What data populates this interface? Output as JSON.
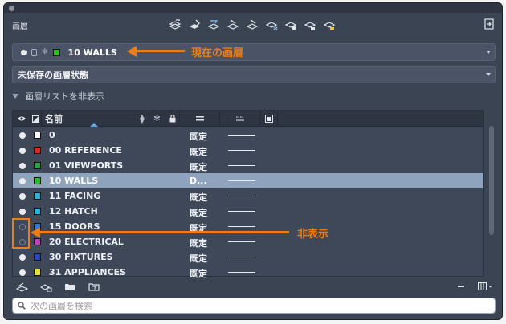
{
  "panel": {
    "label": "画層",
    "toolbar_top": [
      {
        "icon": "layer-properties-icon"
      },
      {
        "icon": "new-layer-icon"
      },
      {
        "icon": "set-current-layer-icon"
      },
      {
        "icon": "layer-match-icon"
      },
      {
        "icon": "layer-freeze-icon"
      },
      {
        "icon": "layer-isolate-icon"
      },
      {
        "icon": "layer-off-icon"
      },
      {
        "icon": "layer-lock-icon"
      },
      {
        "icon": "layer-unlock-icon"
      }
    ],
    "dock_icon": "dock-icon"
  },
  "current_layer": {
    "name": "10 WALLS",
    "color": "#22c41e"
  },
  "layer_state": {
    "label": "未保存の画層状態"
  },
  "list_toggle": {
    "label": "画層リストを非表示"
  },
  "annotations": {
    "current_layer": "現在の画層",
    "hidden": "非表示",
    "color": "#ef7d12"
  },
  "columns": {
    "name": "名前"
  },
  "layers": [
    {
      "name": "0",
      "color": "#ffffff",
      "visible": true,
      "linetype": "既定",
      "selected": false
    },
    {
      "name": "00 REFERENCE",
      "color": "#e52620",
      "visible": true,
      "linetype": "既定",
      "selected": false
    },
    {
      "name": "01 VIEWPORTS",
      "color": "#2aa24a",
      "visible": true,
      "linetype": "既定",
      "selected": false
    },
    {
      "name": "10 WALLS",
      "color": "#22c41e",
      "visible": true,
      "linetype": "D...",
      "selected": true
    },
    {
      "name": "11 FACING",
      "color": "#1fb6e8",
      "visible": true,
      "linetype": "既定",
      "selected": false
    },
    {
      "name": "12 HATCH",
      "color": "#1fb6e8",
      "visible": true,
      "linetype": "既定",
      "selected": false
    },
    {
      "name": "15 DOORS",
      "color": "#2a7be6",
      "visible": false,
      "linetype": "既定",
      "selected": false
    },
    {
      "name": "20 ELECTRICAL",
      "color": "#c93bc7",
      "visible": false,
      "linetype": "既定",
      "selected": false
    },
    {
      "name": "30 FIXTURES",
      "color": "#2146d6",
      "visible": true,
      "linetype": "既定",
      "selected": false
    },
    {
      "name": "31 APPLIANCES",
      "color": "#e8e020",
      "visible": true,
      "linetype": "既定",
      "selected": false
    }
  ],
  "toolbar_bottom": [
    {
      "icon": "layer-stack-icon"
    },
    {
      "icon": "layer-settings-icon"
    },
    {
      "icon": "open-folder-icon"
    },
    {
      "icon": "filter-folder-icon"
    }
  ],
  "search": {
    "placeholder": "次の画層を検索"
  }
}
